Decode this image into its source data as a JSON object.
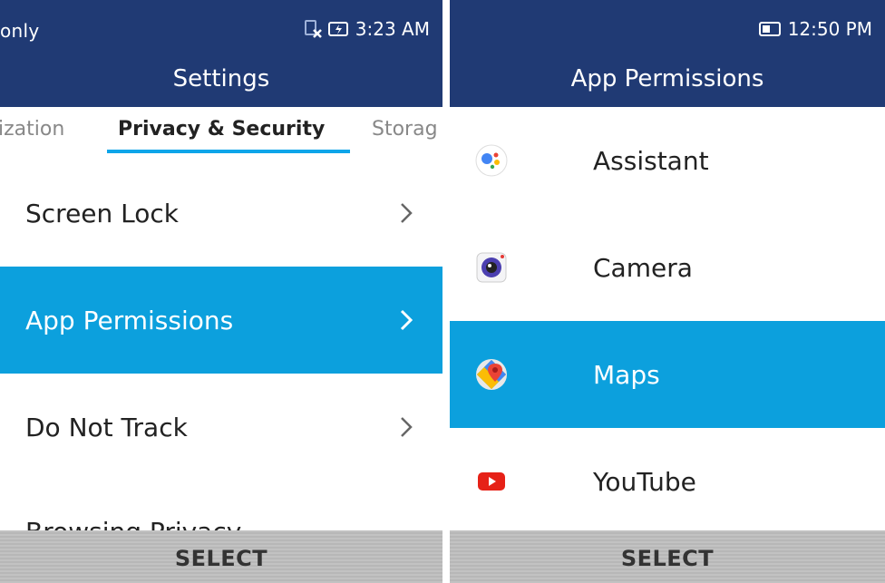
{
  "left": {
    "status": {
      "carrier_text": "only",
      "time": "3:23 AM"
    },
    "title": "Settings",
    "tabs": [
      {
        "label": "ization"
      },
      {
        "label": "Privacy & Security"
      },
      {
        "label": "Storag"
      }
    ],
    "items": [
      {
        "label": "Screen Lock"
      },
      {
        "label": "App Permissions"
      },
      {
        "label": "Do Not Track"
      },
      {
        "label": "Browsing Privacy"
      }
    ],
    "softkey": "SELECT"
  },
  "right": {
    "status": {
      "time": "12:50 PM"
    },
    "title": "App Permissions",
    "apps": [
      {
        "label": "Assistant",
        "icon": "assistant-icon"
      },
      {
        "label": "Camera",
        "icon": "camera-icon"
      },
      {
        "label": "Maps",
        "icon": "maps-icon"
      },
      {
        "label": "YouTube",
        "icon": "youtube-icon"
      }
    ],
    "softkey": "SELECT"
  },
  "colors": {
    "header": "#203a74",
    "selected": "#0ca0dd",
    "tab_underline": "#0ea5e9"
  }
}
